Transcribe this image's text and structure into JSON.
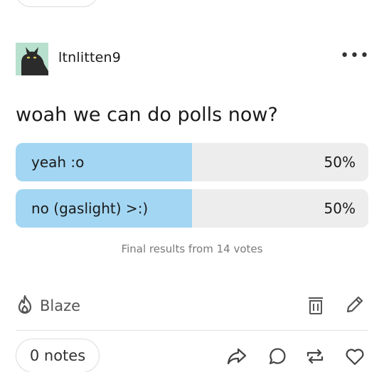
{
  "post": {
    "username": "ltnlitten9",
    "more_label": "•••",
    "question": "woah we can do polls now?"
  },
  "poll": {
    "options": [
      {
        "label": "yeah :o",
        "percent_label": "50%",
        "fill_fraction": 0.5
      },
      {
        "label": "no (gaslight) >:)",
        "percent_label": "50%",
        "fill_fraction": 0.5
      }
    ],
    "results_text": "Final results from 14 votes"
  },
  "actions": {
    "blaze_label": "Blaze",
    "notes_label": "0 notes"
  },
  "colors": {
    "poll_fill": "#a3d6f2",
    "poll_track": "#ededed",
    "avatar_bg": "#b8e0cf"
  },
  "icons": [
    "flame-icon",
    "trash-icon",
    "edit-pencil-icon",
    "share-icon",
    "reply-icon",
    "reblog-icon",
    "like-heart-icon"
  ]
}
